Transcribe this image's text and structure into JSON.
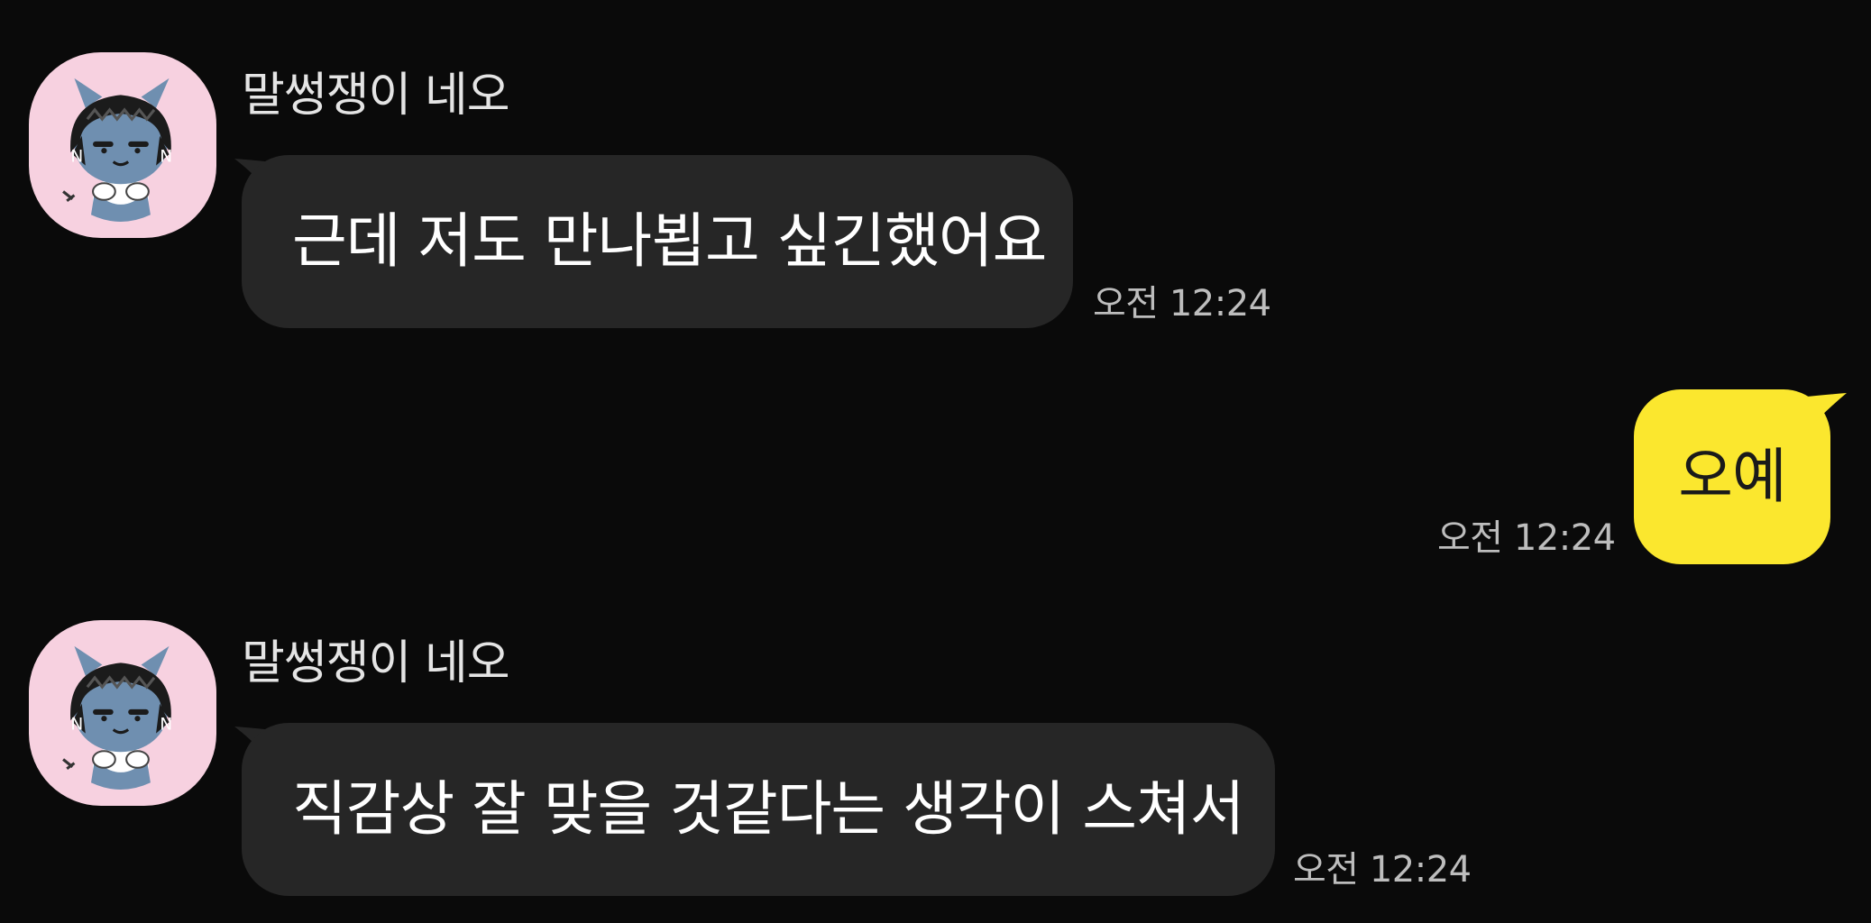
{
  "messages": [
    {
      "direction": "incoming",
      "sender": "말썽쟁이 네오",
      "text": "근데 저도 만나뵙고 싶긴했어요",
      "time": "오전 12:24"
    },
    {
      "direction": "outgoing",
      "text": "오예",
      "time": "오전 12:24"
    },
    {
      "direction": "incoming",
      "sender": "말썽쟁이 네오",
      "text": "직감상 잘 맞을 것같다는 생각이 스쳐서",
      "time": "오전 12:24"
    }
  ],
  "colors": {
    "background": "#0a0a0a",
    "incoming_bubble": "#262626",
    "outgoing_bubble": "#fbe72e",
    "avatar_background": "#f7d1e0",
    "timestamp_text": "#bdbdbd"
  },
  "icons": {
    "avatar": "neo-character-avatar-icon"
  }
}
